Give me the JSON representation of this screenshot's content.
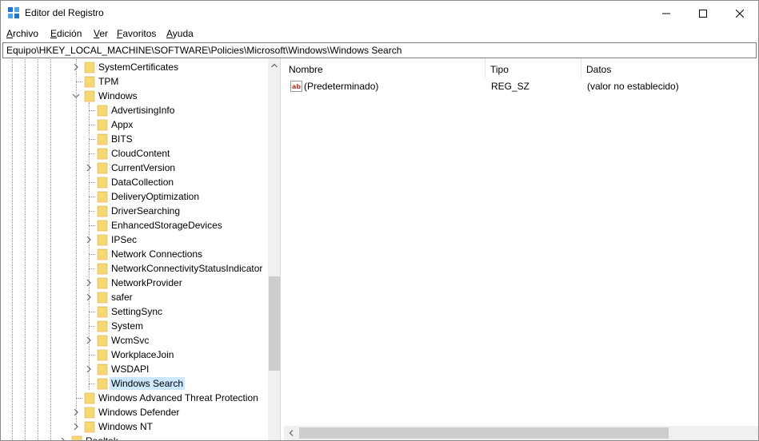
{
  "window": {
    "title": "Editor del Registro",
    "icon": "registry-editor-icon"
  },
  "menu": {
    "items": [
      {
        "accel": "A",
        "rest": "rchivo"
      },
      {
        "accel": "E",
        "rest": "dición"
      },
      {
        "accel": "V",
        "rest": "er"
      },
      {
        "accel": "F",
        "rest": "avoritos"
      },
      {
        "accel": "A",
        "rest": "yuda"
      }
    ]
  },
  "address": {
    "path": "Equipo\\HKEY_LOCAL_MACHINE\\SOFTWARE\\Policies\\Microsoft\\Windows\\Windows Search"
  },
  "tree": {
    "items": [
      {
        "label": "SystemCertificates",
        "level": 0,
        "chevron": "right",
        "selected": false
      },
      {
        "label": "TPM",
        "level": 0,
        "chevron": "none",
        "selected": false
      },
      {
        "label": "Windows",
        "level": 0,
        "chevron": "down",
        "selected": false
      },
      {
        "label": "AdvertisingInfo",
        "level": 1,
        "chevron": "none",
        "selected": false
      },
      {
        "label": "Appx",
        "level": 1,
        "chevron": "none",
        "selected": false
      },
      {
        "label": "BITS",
        "level": 1,
        "chevron": "none",
        "selected": false
      },
      {
        "label": "CloudContent",
        "level": 1,
        "chevron": "none",
        "selected": false
      },
      {
        "label": "CurrentVersion",
        "level": 1,
        "chevron": "right",
        "selected": false
      },
      {
        "label": "DataCollection",
        "level": 1,
        "chevron": "none",
        "selected": false
      },
      {
        "label": "DeliveryOptimization",
        "level": 1,
        "chevron": "none",
        "selected": false
      },
      {
        "label": "DriverSearching",
        "level": 1,
        "chevron": "none",
        "selected": false
      },
      {
        "label": "EnhancedStorageDevices",
        "level": 1,
        "chevron": "none",
        "selected": false
      },
      {
        "label": "IPSec",
        "level": 1,
        "chevron": "right",
        "selected": false
      },
      {
        "label": "Network Connections",
        "level": 1,
        "chevron": "none",
        "selected": false
      },
      {
        "label": "NetworkConnectivityStatusIndicator",
        "level": 1,
        "chevron": "none",
        "selected": false
      },
      {
        "label": "NetworkProvider",
        "level": 1,
        "chevron": "right",
        "selected": false
      },
      {
        "label": "safer",
        "level": 1,
        "chevron": "right",
        "selected": false
      },
      {
        "label": "SettingSync",
        "level": 1,
        "chevron": "none",
        "selected": false
      },
      {
        "label": "System",
        "level": 1,
        "chevron": "none",
        "selected": false
      },
      {
        "label": "WcmSvc",
        "level": 1,
        "chevron": "right",
        "selected": false
      },
      {
        "label": "WorkplaceJoin",
        "level": 1,
        "chevron": "none",
        "selected": false
      },
      {
        "label": "WSDAPI",
        "level": 1,
        "chevron": "right",
        "selected": false
      },
      {
        "label": "Windows Search",
        "level": 1,
        "chevron": "none",
        "selected": true
      },
      {
        "label": "Windows Advanced Threat Protection",
        "level": 0,
        "chevron": "none",
        "selected": false
      },
      {
        "label": "Windows Defender",
        "level": 0,
        "chevron": "right",
        "selected": false
      },
      {
        "label": "Windows NT",
        "level": 0,
        "chevron": "right",
        "selected": false
      },
      {
        "label": "Realtek",
        "level": -1,
        "chevron": "right",
        "selected": false
      }
    ]
  },
  "list": {
    "columns": [
      "Nombre",
      "Tipo",
      "Datos"
    ],
    "rows": [
      {
        "name": "(Predeterminado)",
        "type": "REG_SZ",
        "data": "(valor no establecido)",
        "icon": "string-value-icon"
      }
    ]
  },
  "colors": {
    "selection": "#cce8ff",
    "folder": "#f8d775",
    "scrollbar_track": "#f0f0f0",
    "scrollbar_thumb": "#cdcdcd"
  }
}
